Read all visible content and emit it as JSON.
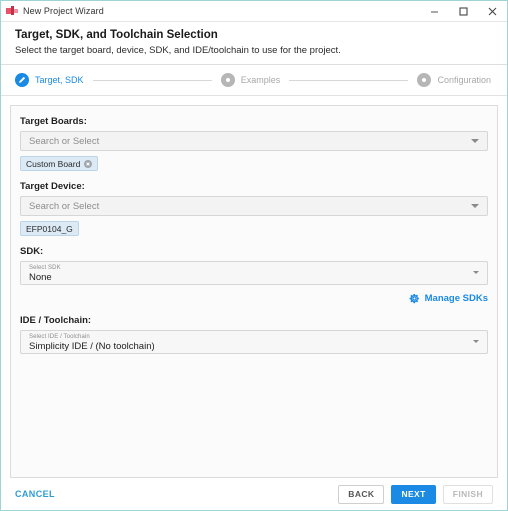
{
  "window": {
    "title": "New Project Wizard",
    "app_icon": "simplicity-studio-icon",
    "controls": {
      "minimize": "minimize-icon",
      "maximize": "maximize-icon",
      "close": "close-icon"
    },
    "border_color": "#9fd4d4"
  },
  "header": {
    "title": "Target, SDK, and Toolchain Selection",
    "subtitle": "Select the target board, device, SDK, and IDE/toolchain to use for the project."
  },
  "stepper": {
    "accent_color": "#1a8ae5",
    "inactive_color": "#b6b6b6",
    "steps": [
      {
        "label": "Target, SDK",
        "state": "active",
        "icon": "pencil-icon"
      },
      {
        "label": "Examples",
        "state": "inactive",
        "icon": "dot-icon"
      },
      {
        "label": "Configuration",
        "state": "inactive",
        "icon": "dot-icon"
      }
    ]
  },
  "form": {
    "target_boards": {
      "label": "Target Boards:",
      "placeholder": "Search or Select",
      "value": "",
      "chips": [
        {
          "text": "Custom Board",
          "removable": true
        }
      ]
    },
    "target_device": {
      "label": "Target Device:",
      "placeholder": "Search or Select",
      "value": "",
      "chips": [
        {
          "text": "EFP0104_G",
          "removable": false
        }
      ]
    },
    "sdk": {
      "label": "SDK:",
      "mini_label": "Select SDK",
      "value": "None"
    },
    "manage_sdks": {
      "label": "Manage SDKs",
      "icon": "gear-icon",
      "color": "#1a8ae5"
    },
    "ide_toolchain": {
      "label": "IDE / Toolchain:",
      "mini_label": "Select IDE / Toolchain",
      "value": "Simplicity IDE / (No toolchain)"
    }
  },
  "footer": {
    "cancel": "CANCEL",
    "back": "BACK",
    "next": "NEXT",
    "finish": "FINISH"
  }
}
